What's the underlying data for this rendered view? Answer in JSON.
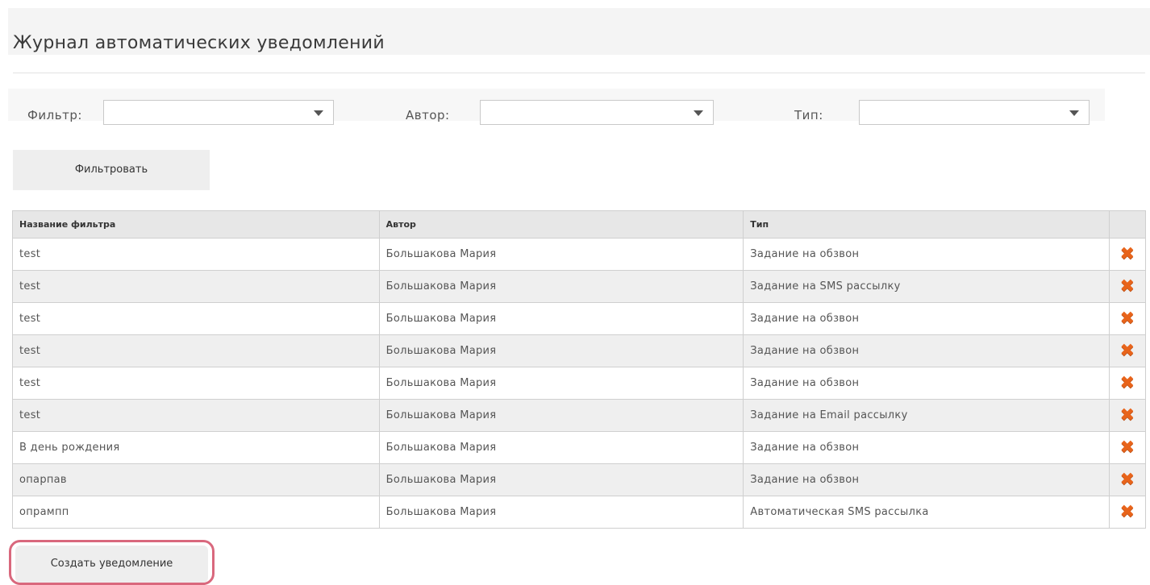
{
  "title": "Журнал автоматических уведомлений",
  "filters": {
    "filter_label": "Фильтр:",
    "author_label": "Автор:",
    "type_label": "Тип:",
    "filter_value": "",
    "author_value": "",
    "type_value": ""
  },
  "buttons": {
    "filter": "Фильтровать",
    "create": "Создать уведомление"
  },
  "table": {
    "headers": [
      "Название фильтра",
      "Автор",
      "Тип",
      ""
    ],
    "rows": [
      {
        "name": "test",
        "author": "Большакова Мария",
        "type": "Задание на обзвон"
      },
      {
        "name": "test",
        "author": "Большакова Мария",
        "type": "Задание на SMS рассылку"
      },
      {
        "name": "test",
        "author": "Большакова Мария",
        "type": "Задание на обзвон"
      },
      {
        "name": "test",
        "author": "Большакова Мария",
        "type": "Задание на обзвон"
      },
      {
        "name": "test",
        "author": "Большакова Мария",
        "type": "Задание на обзвон"
      },
      {
        "name": "test",
        "author": "Большакова Мария",
        "type": "Задание на Email рассылку"
      },
      {
        "name": "В день рождения",
        "author": "Большакова Мария",
        "type": "Задание на обзвон"
      },
      {
        "name": "опарпав",
        "author": "Большакова Мария",
        "type": "Задание на обзвон"
      },
      {
        "name": "опрампп",
        "author": "Большакова Мария",
        "type": "Автоматическая SMS рассылка"
      }
    ],
    "delete_icon": "delete-x-icon"
  },
  "colors": {
    "delete_icon": "#e8641b",
    "create_highlight": "#d9687d"
  }
}
